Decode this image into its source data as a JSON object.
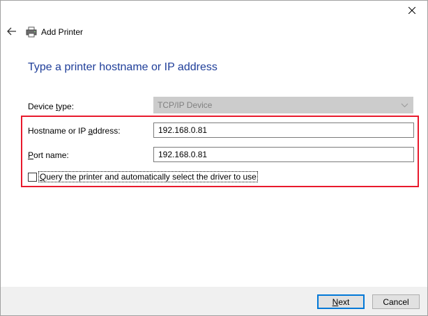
{
  "window": {
    "title": "Add Printer",
    "close_icon": "close-icon",
    "back_icon": "back-arrow-icon",
    "title_icon": "printer-icon"
  },
  "heading": "Type a printer hostname or IP address",
  "device_type": {
    "label_pre": "Device ",
    "label_u": "t",
    "label_post": "ype:",
    "value": "TCP/IP Device"
  },
  "hostname": {
    "label_pre": "Hostname or IP ",
    "label_u": "a",
    "label_post": "ddress:",
    "value": "192.168.0.81"
  },
  "port": {
    "label_u": "P",
    "label_post": "ort name:",
    "value": "192.168.0.81"
  },
  "query": {
    "label_u": "Q",
    "label_post": "uery the printer and automatically select the driver to use",
    "checked": false
  },
  "buttons": {
    "next_u": "N",
    "next_post": "ext",
    "cancel": "Cancel"
  },
  "colors": {
    "heading": "#1f3e99",
    "highlight": "#e8192c",
    "primary_border": "#0078d7"
  }
}
